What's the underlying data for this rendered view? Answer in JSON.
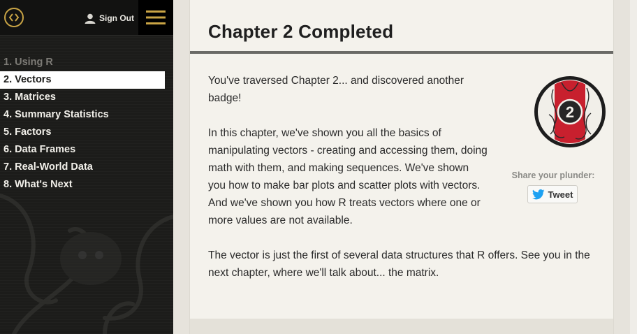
{
  "header": {
    "logo_icon": "code-brackets-icon",
    "signout_label": "Sign Out",
    "menu_icon": "hamburger-icon"
  },
  "sidebar": {
    "items": [
      {
        "label": "1. Using R",
        "state": "completed"
      },
      {
        "label": "2. Vectors",
        "state": "active"
      },
      {
        "label": "3. Matrices",
        "state": "normal"
      },
      {
        "label": "4. Summary Statistics",
        "state": "normal"
      },
      {
        "label": "5. Factors",
        "state": "normal"
      },
      {
        "label": "6. Data Frames",
        "state": "normal"
      },
      {
        "label": "7. Real-World Data",
        "state": "normal"
      },
      {
        "label": "8. What's Next",
        "state": "normal"
      }
    ]
  },
  "main": {
    "title": "Chapter 2 Completed",
    "paragraphs": [
      "You've traversed Chapter 2... and discovered another badge!",
      "In this chapter, we've shown you all the basics of manipulating vectors - creating and accessing them, doing math with them, and making sequences. We've shown you how to make bar plots and scatter plots with vectors. And we've shown you how R treats vectors where one or more values are not available.",
      "The vector is just the first of several data structures that R offers. See you in the next chapter, where we'll talk about... the matrix."
    ],
    "badge_number": "2",
    "share_label": "Share your plunder:",
    "tweet_label": "Tweet"
  },
  "colors": {
    "accent_gold": "#c9a445",
    "sidebar_bg": "#1c1c1a",
    "badge_red": "#c8202e",
    "twitter_blue": "#1da1f2"
  }
}
